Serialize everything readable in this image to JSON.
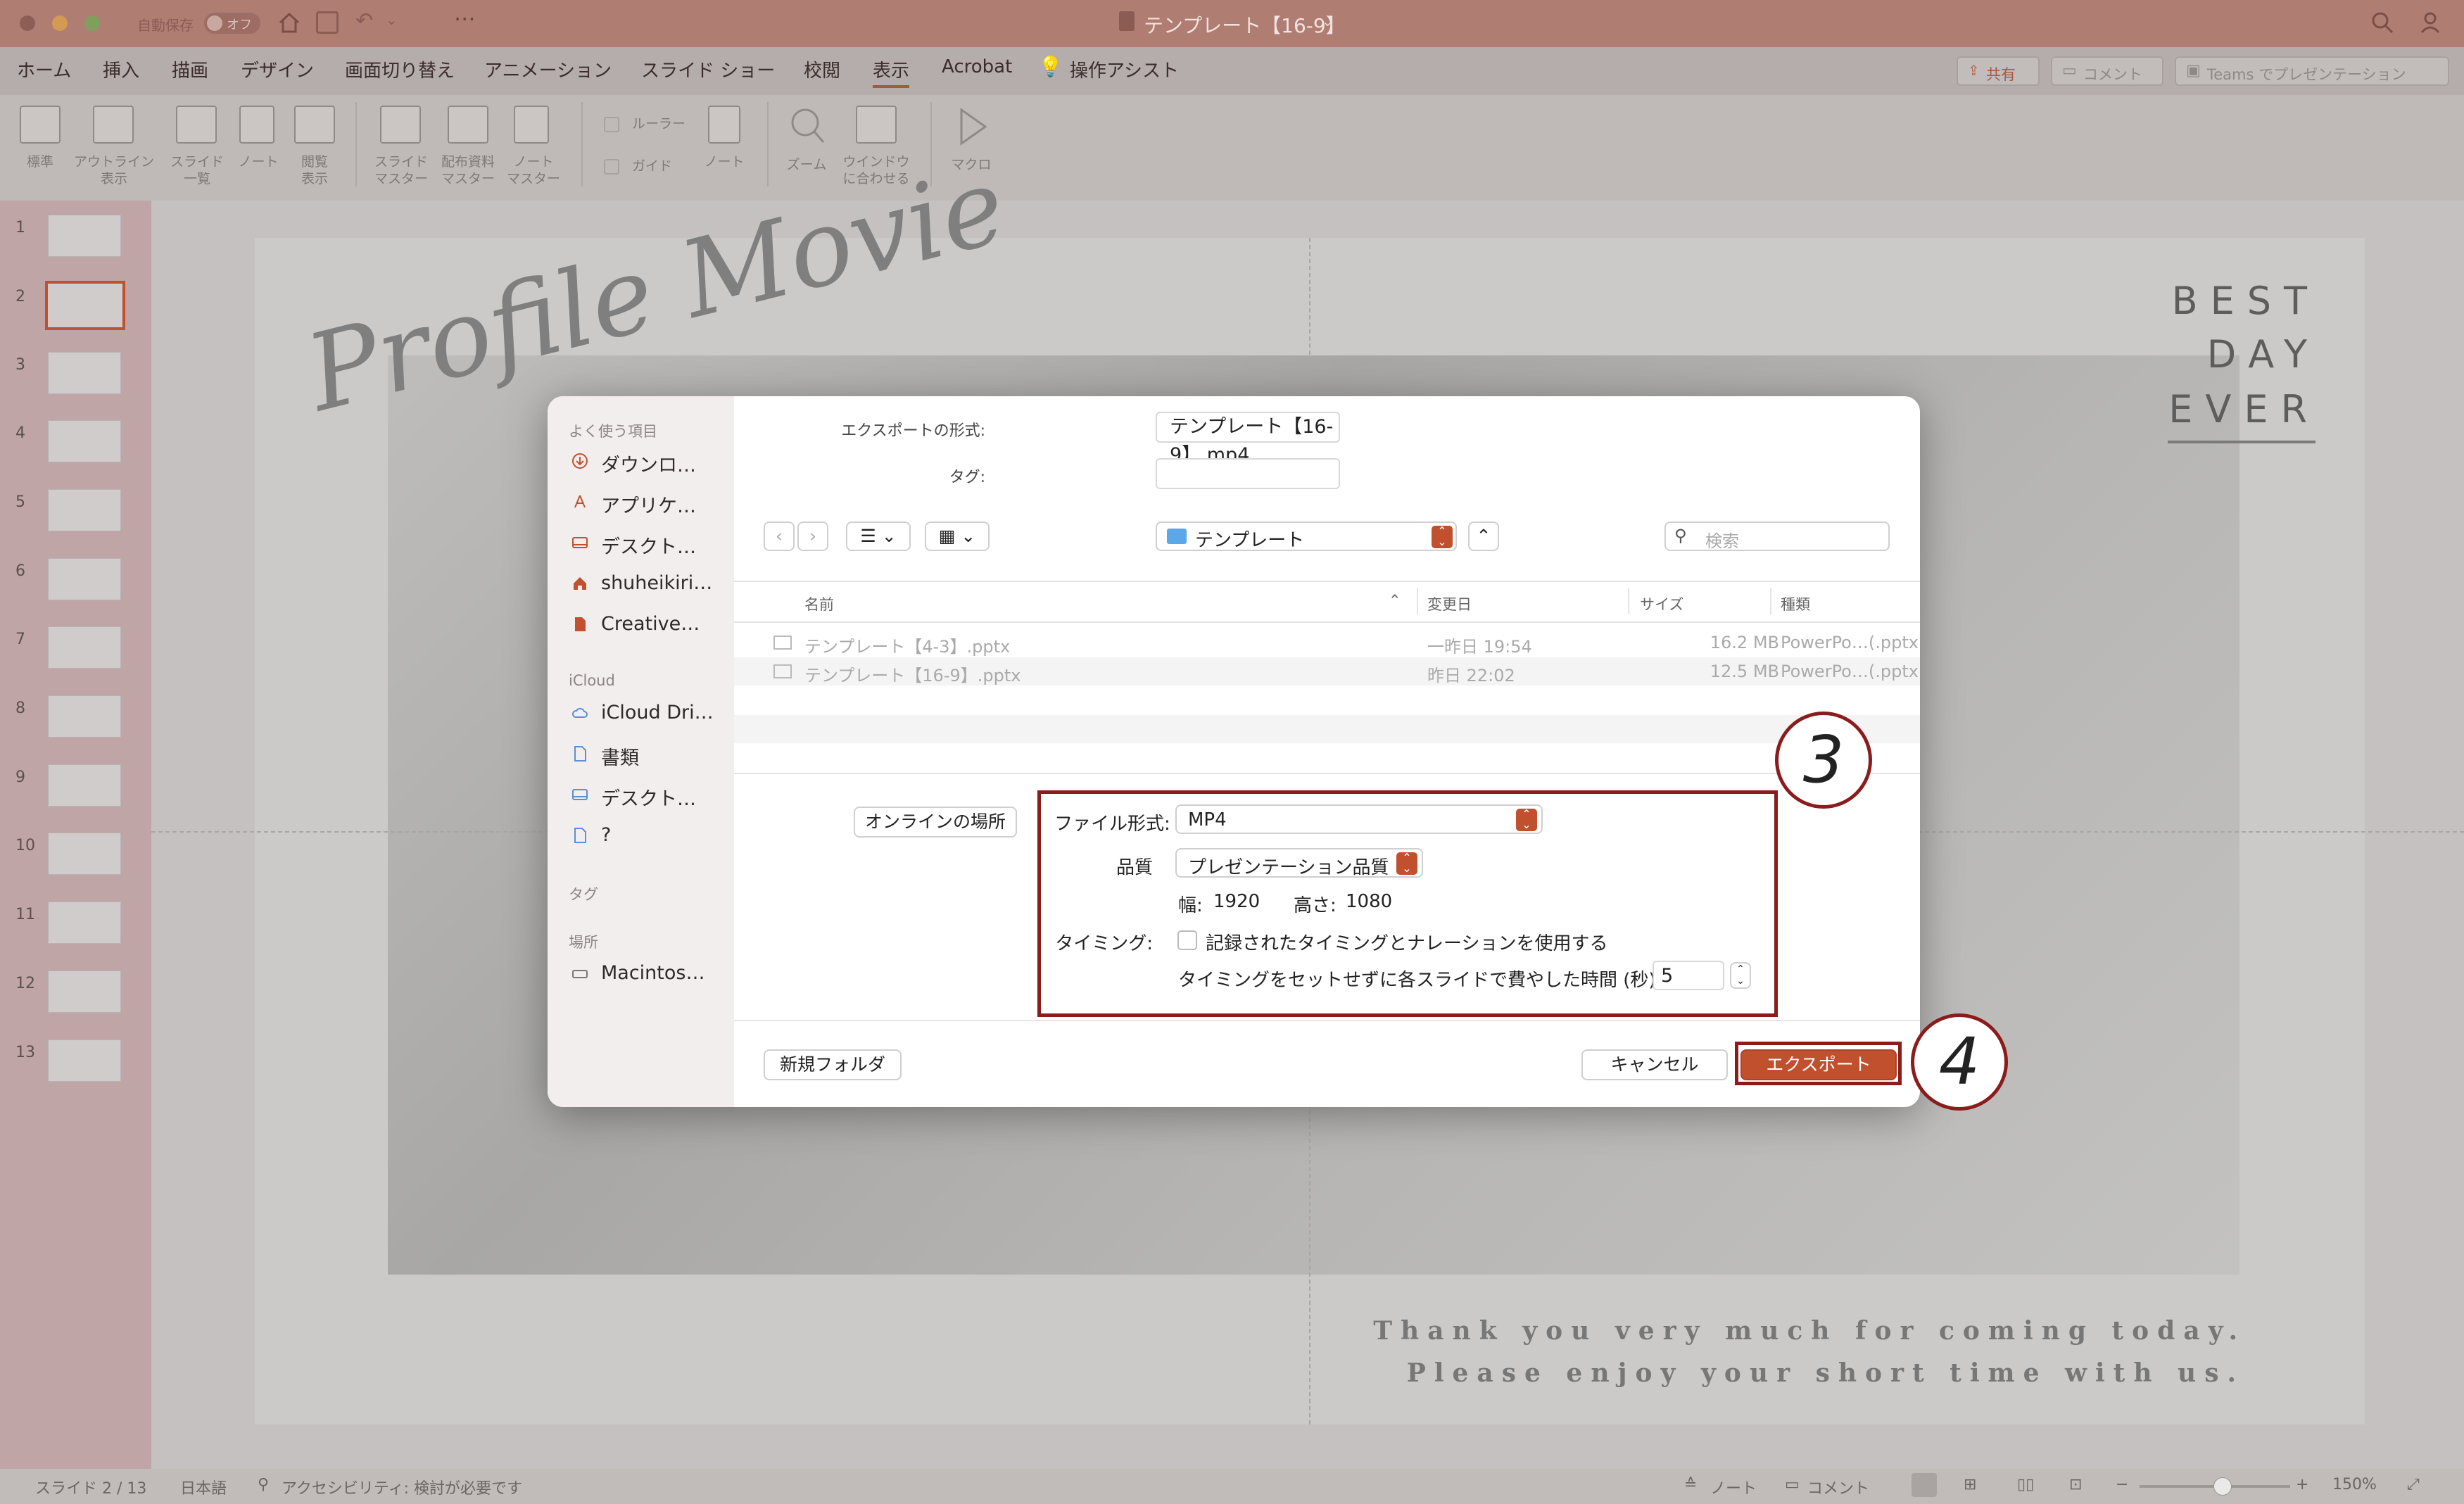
{
  "window": {
    "autosave": "自動保存",
    "autosave_state": "オフ",
    "title": "テンプレート【16-9】",
    "share": "共有",
    "comment": "コメント",
    "teams": "Teams でプレゼンテーション"
  },
  "menu": [
    "ホーム",
    "挿入",
    "描画",
    "デザイン",
    "画面切り替え",
    "アニメーション",
    "スライド ショー",
    "校閲",
    "表示",
    "Acrobat",
    "操作アシスト"
  ],
  "ribbon": {
    "standard": "標準",
    "outline": "アウトライン",
    "outline2": "表示",
    "sorter": "スライド",
    "sorter2": "一覧",
    "notes": "ノート",
    "reading": "閲覧",
    "reading2": "表示",
    "slide_master": "スライド",
    "slide_master2": "マスター",
    "handout_master": "配布資料",
    "handout_master2": "マスター",
    "notes_master": "ノート",
    "notes_master2": "マスター",
    "ruler": "ルーラー",
    "guide": "ガイド",
    "notes_pane": "ノート",
    "zoom": "ズーム",
    "fit": "ウインドウ",
    "fit2": "に合わせる",
    "macro": "マクロ"
  },
  "slides": [
    "1",
    "2",
    "3",
    "4",
    "5",
    "6",
    "7",
    "8",
    "9",
    "10",
    "11",
    "12",
    "13"
  ],
  "slide": {
    "script_title": "Profile Movie",
    "best": "BEST",
    "day": "DAY",
    "ever": "EVER",
    "thanks1": "Thank you very much for coming today.",
    "thanks2": "Please enjoy your short time with us."
  },
  "dialog": {
    "favorites_header": "よく使う項目",
    "favorites": [
      "ダウンロ…",
      "アプリケ…",
      "デスクト…",
      "shuheikiri…",
      "Creative…"
    ],
    "icloud_header": "iCloud",
    "icloud": [
      "iCloud Dri…",
      "書類",
      "デスクト…",
      "?"
    ],
    "tags_header": "タグ",
    "locations_header": "場所",
    "locations": [
      "Macintos…"
    ],
    "export_as_label": "エクスポートの形式:",
    "export_as_value": "テンプレート【16-9】.mp4",
    "tags_label": "タグ:",
    "tags_value": "",
    "folder": "テンプレート",
    "search_placeholder": "検索",
    "columns": {
      "name": "名前",
      "modified": "変更日",
      "size": "サイズ",
      "kind": "種類"
    },
    "files": [
      {
        "name": "テンプレート【4-3】.pptx",
        "modified": "一昨日 19:54",
        "size": "16.2 MB",
        "kind": "PowerPo…(.pptx)"
      },
      {
        "name": "テンプレート【16-9】.pptx",
        "modified": "昨日 22:02",
        "size": "12.5 MB",
        "kind": "PowerPo…(.pptx)"
      }
    ],
    "online_button": "オンラインの場所",
    "format_label": "ファイル形式:",
    "format_value": "MP4",
    "quality_label": "品質",
    "quality_value": "プレゼンテーション品質",
    "width_label": "幅:",
    "width_value": "1920",
    "height_label": "高さ:",
    "height_value": "1080",
    "timing_label": "タイミング:",
    "timing_checkbox": "記録されたタイミングとナレーションを使用する",
    "timing_seconds_label": "タイミングをセットせずに各スライドで費やした時間 (秒):",
    "timing_seconds_value": "5",
    "new_folder": "新規フォルダ",
    "cancel": "キャンセル",
    "export": "エクスポート"
  },
  "annotations": {
    "step3": "3",
    "step4": "4"
  },
  "status": {
    "slide": "スライド 2 / 13",
    "language": "日本語",
    "accessibility": "アクセシビリティ: 検討が必要です",
    "notes": "ノート",
    "comments": "コメント",
    "zoom": "150%"
  },
  "colors": {
    "accent": "#c0502e",
    "annotation": "#8a1c1c",
    "titlebar": "#b07d72"
  }
}
